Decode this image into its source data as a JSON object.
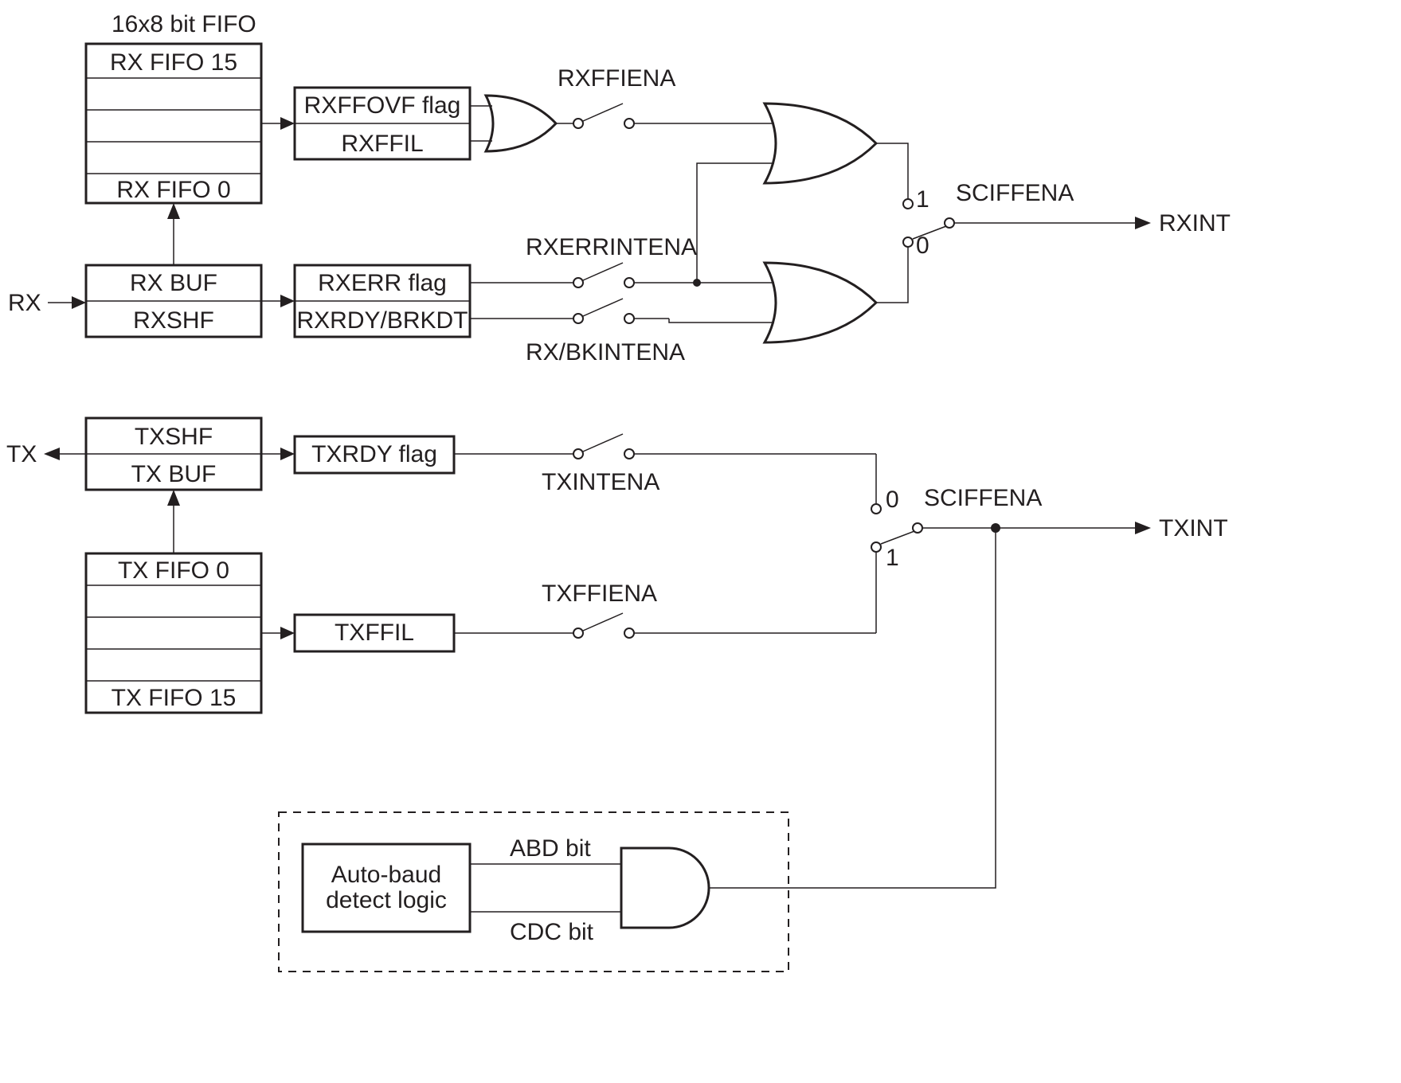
{
  "title": "16x8 bit  FIFO",
  "rx_fifo_top": "RX FIFO 15",
  "rx_fifo_bot": "RX FIFO 0",
  "rx_buf": "RX BUF",
  "rx_shf": "RXSHF",
  "rxffovf": "RXFFOVF flag",
  "rxffil": "RXFFIL",
  "rxerr": "RXERR flag",
  "rxrdy": "RXRDY/BRKDT",
  "rxffiena": "RXFFIENA",
  "rxerrintena": "RXERRINTENA",
  "rxbkintena": "RX/BKINTENA",
  "sciffena_rx": "SCIFFENA",
  "rxint": "RXINT",
  "one": "1",
  "zero": "0",
  "rx_label": "RX",
  "tx_label": "TX",
  "txshf": "TXSHF",
  "txbuf": "TX BUF",
  "tx_fifo_top": "TX FIFO 0",
  "tx_fifo_bot": "TX FIFO 15",
  "txrdy": "TXRDY flag",
  "txffil": "TXFFIL",
  "txintena": "TXINTENA",
  "txffiena": "TXFFIENA",
  "sciffena_tx": "SCIFFENA",
  "txint": "TXINT",
  "autobaud": "Auto-baud",
  "autobaud2": "detect logic",
  "abd": "ABD bit",
  "cdc": "CDC bit"
}
